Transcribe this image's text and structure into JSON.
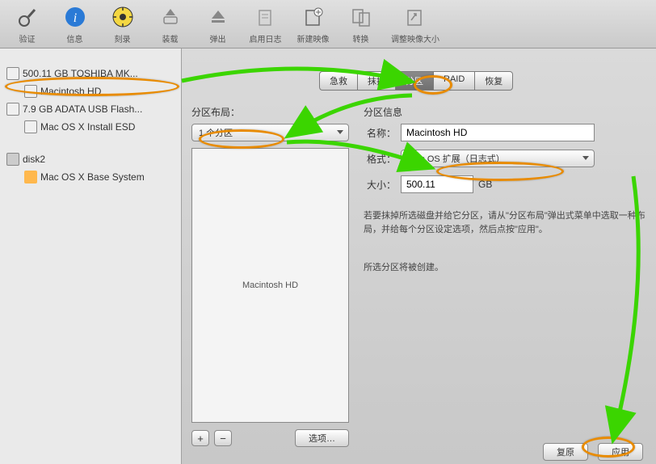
{
  "toolbar": {
    "items": [
      {
        "icon": "microscope",
        "label": "验证"
      },
      {
        "icon": "info",
        "label": "信息"
      },
      {
        "icon": "burn",
        "label": "刻录"
      },
      {
        "icon": "mount",
        "label": "装载"
      },
      {
        "icon": "eject",
        "label": "弹出"
      },
      {
        "icon": "journal",
        "label": "启用日志"
      },
      {
        "icon": "newimg",
        "label": "新建映像"
      },
      {
        "icon": "convert",
        "label": "转换"
      },
      {
        "icon": "resize",
        "label": "调整映像大小"
      }
    ]
  },
  "sidebar": {
    "items": [
      {
        "label": "500.11 GB TOSHIBA MK...",
        "icon": "disk",
        "selected": false
      },
      {
        "label": "Macintosh HD",
        "icon": "disk",
        "indent": true
      },
      {
        "label": "7.9 GB ADATA USB Flash...",
        "icon": "disk"
      },
      {
        "label": "Mac OS X Install ESD",
        "icon": "disk",
        "indent": true
      }
    ],
    "disk2_label": "disk2",
    "disk2_child": "Mac OS X Base System"
  },
  "tabs": {
    "aid": "急救",
    "erase": "抹掉",
    "partition": "分区",
    "raid": "RAID",
    "restore": "恢复"
  },
  "left": {
    "layout_title": "分区布局：",
    "layout_value": "1 个分区",
    "canvas_label": "Macintosh HD",
    "options_btn": "选项…"
  },
  "right": {
    "info_title": "分区信息",
    "name_label": "名称：",
    "name_value": "Macintosh HD",
    "format_label": "格式：",
    "format_value": "Mac OS 扩展（日志式）",
    "size_label": "大小：",
    "size_value": "500.11",
    "size_unit": "GB",
    "help_text": "若要抹掉所选磁盘并给它分区，请从\"分区布局\"弹出式菜单中选取一种布局，并给每个分区设定选项，然后点按\"应用\"。",
    "status": "所选分区将被创建。",
    "revert_btn": "复原",
    "apply_btn": "应用"
  }
}
